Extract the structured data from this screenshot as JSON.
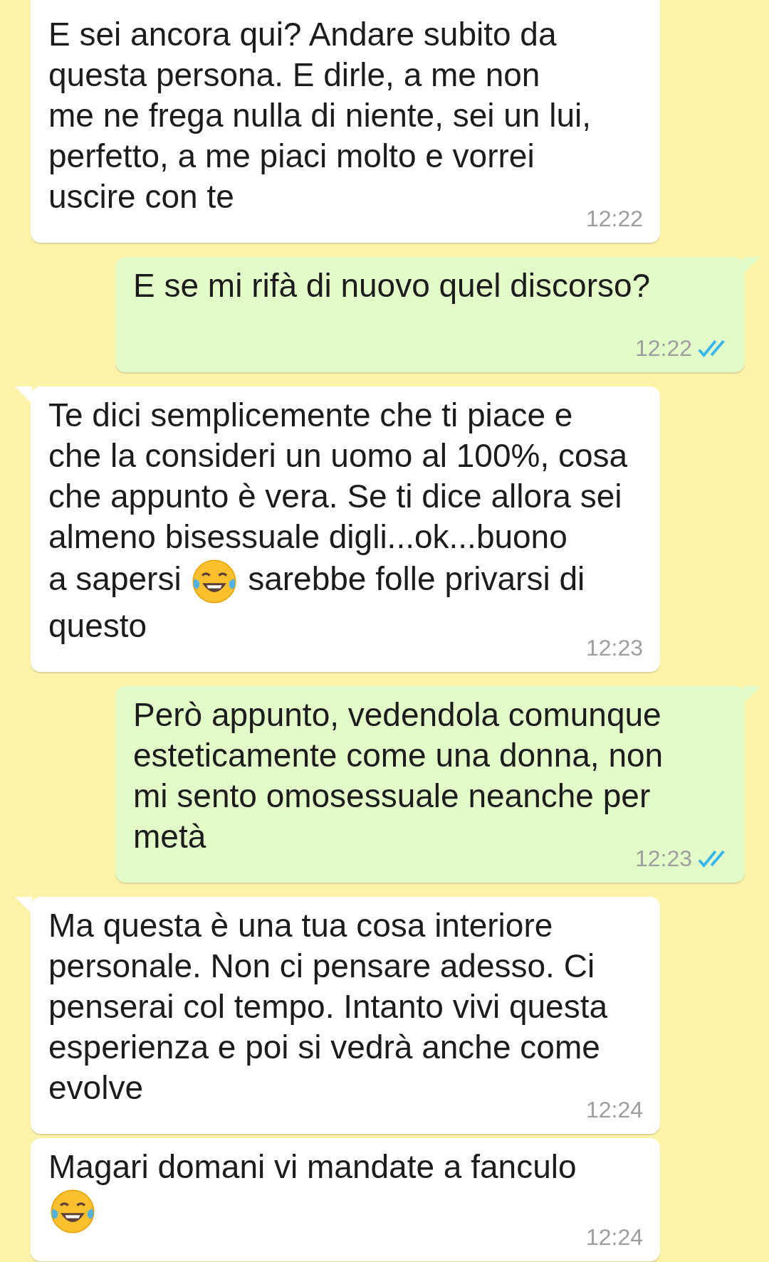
{
  "messages": [
    {
      "kind": "incoming",
      "tail": false,
      "parts": [
        {
          "kind": "text",
          "text": "E sei ancora qui? Andare subito da\nquesta persona. E dirle, a me non\nme ne frega nulla di niente, sei un lui,\nperfetto, a me piaci molto e vorrei\nuscire con te"
        }
      ],
      "time": "12:22"
    },
    {
      "kind": "outgoing",
      "tail": true,
      "parts": [
        {
          "kind": "text",
          "text": "E se mi rifà di nuovo quel discorso?"
        }
      ],
      "time": "12:22",
      "read": true
    },
    {
      "kind": "incoming",
      "tail": true,
      "parts": [
        {
          "kind": "text",
          "text": "Te dici semplicemente che ti piace e\nche la consideri un uomo al 100%, cosa\nche appunto è vera. Se ti dice allora sei\nalmeno bisessuale digli...ok...buono\na sapersi "
        },
        {
          "kind": "emoji"
        },
        {
          "kind": "text",
          "text": " sarebbe folle privarsi di\nquesto"
        }
      ],
      "time": "12:23"
    },
    {
      "kind": "outgoing",
      "tail": true,
      "parts": [
        {
          "kind": "text",
          "text": "Però appunto, vedendola comunque\nesteticamente come una donna, non\nmi sento omosessuale neanche per\nmetà"
        }
      ],
      "time": "12:23",
      "read": true
    },
    {
      "kind": "incoming",
      "tail": true,
      "parts": [
        {
          "kind": "text",
          "text": "Ma questa è una tua cosa interiore\npersonale. Non ci pensare adesso. Ci\npenserai col tempo. Intanto vivi questa\nesperienza e poi si vedrà anche come\nevolve"
        }
      ],
      "time": "12:24"
    },
    {
      "kind": "incoming",
      "tail": false,
      "parts": [
        {
          "kind": "text",
          "text": "Magari domani vi mandate a fanculo\n"
        },
        {
          "kind": "emoji"
        }
      ],
      "time": "12:24"
    }
  ]
}
